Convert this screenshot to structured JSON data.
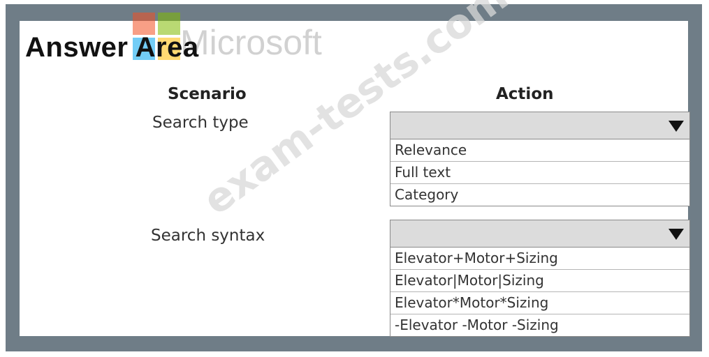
{
  "answer_area": {
    "title": "Answer Area"
  },
  "watermarks": {
    "brand": "Microsoft",
    "site": "exam-tests.com"
  },
  "headers": {
    "scenario": "Scenario",
    "action": "Action"
  },
  "rows": [
    {
      "scenario": "Search type",
      "options": [
        "Relevance",
        "Full text",
        "Category"
      ]
    },
    {
      "scenario": "Search syntax",
      "options": [
        "Elevator+Motor+Sizing",
        "Elevator|Motor|Sizing",
        "Elevator*Motor*Sizing",
        "-Elevator -Motor -Sizing"
      ]
    }
  ],
  "colors": {
    "frame": "#6f7d87",
    "dropdown_header": "#dcdcdc",
    "logo_red": "#f25022",
    "logo_green": "#7fba00",
    "logo_blue": "#00a4ef",
    "logo_yellow": "#ffb900"
  },
  "icons": {
    "dropdown": "triangle-down-icon",
    "logo": "microsoft-logo-icon"
  }
}
